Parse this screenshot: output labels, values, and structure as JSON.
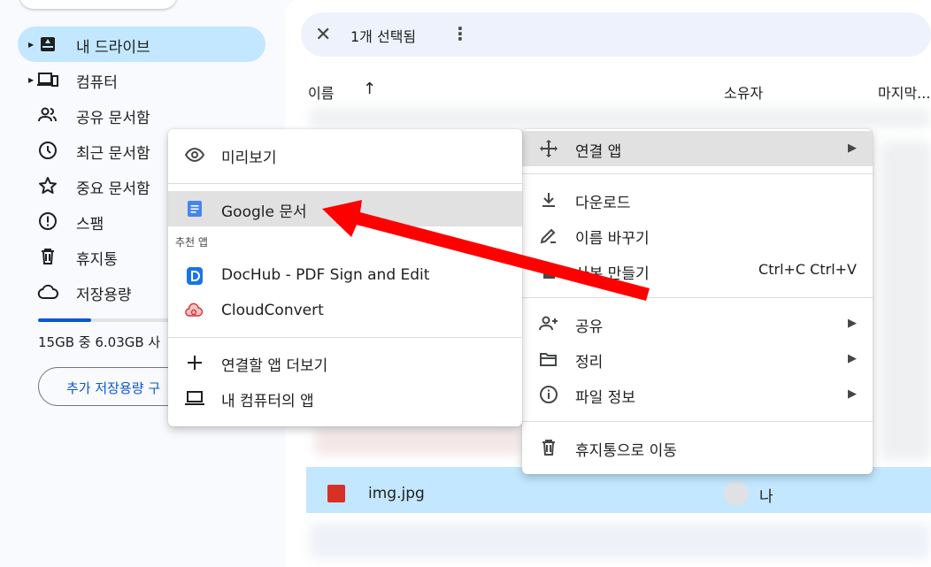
{
  "sidebar": {
    "items": [
      {
        "label": "내 드라이브",
        "icon": "drive-icon"
      },
      {
        "label": "컴퓨터",
        "icon": "computer-icon"
      },
      {
        "label": "공유 문서함",
        "icon": "shared-icon"
      },
      {
        "label": "최근 문서함",
        "icon": "clock-icon"
      },
      {
        "label": "중요 문서함",
        "icon": "star-icon"
      },
      {
        "label": "스팸",
        "icon": "spam-icon"
      },
      {
        "label": "휴지통",
        "icon": "trash-icon"
      },
      {
        "label": "저장용량",
        "icon": "cloud-icon"
      }
    ],
    "storage_text": "15GB 중 6.03GB 사",
    "storage_fraction": 0.4,
    "more_storage": "추가 저장용량 구"
  },
  "selection_bar": {
    "close": "✕",
    "count": "1개 선택됨",
    "more": "⋮"
  },
  "columns": {
    "name": "이름",
    "sort_arrow": "↑",
    "owner": "소유자",
    "modified": "마지막..."
  },
  "selected_file": {
    "name": "img.jpg",
    "owner": "나"
  },
  "open_with_menu": {
    "preview": "미리보기",
    "google_docs": "Google 문서",
    "section": "추천 앱",
    "dochub": "DocHub - PDF Sign and Edit",
    "cloudconvert": "CloudConvert",
    "more_apps": "연결할 앱 더보기",
    "computer_apps": "내 컴퓨터의 앱"
  },
  "context_menu": {
    "open_with": "연결 앱",
    "download": "다운로드",
    "rename": "이름 바꾸기",
    "copy": "사본 만들기",
    "copy_shortcut": "Ctrl+C Ctrl+V",
    "share": "공유",
    "organize": "정리",
    "info": "파일 정보",
    "trash": "휴지통으로 이동"
  },
  "colors": {
    "accent": "#0b57d0",
    "selected_bg": "#c2e7ff",
    "arrow": "#ff0000"
  }
}
